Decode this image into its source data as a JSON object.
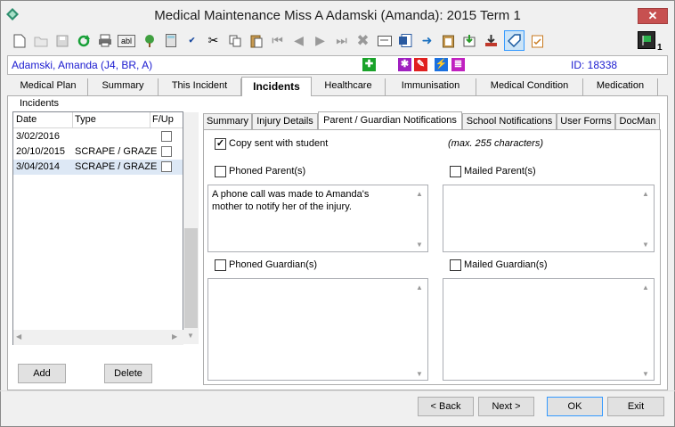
{
  "window": {
    "title": "Medical Maintenance   Miss A Adamski (Amanda): 2015 Term 1",
    "close_label": "✕"
  },
  "toolbar": {
    "icons": [
      "new-icon",
      "open-icon",
      "save-icon",
      "refresh-icon",
      "print-icon",
      "abl-icon",
      "tree-icon",
      "calculator-icon",
      "spellcheck-icon",
      "cut-icon",
      "copy-icon",
      "paste-icon",
      "first-icon",
      "prev-icon",
      "next-icon",
      "last-icon",
      "delete-icon",
      "card-icon",
      "word-icon",
      "forward-icon",
      "clipboard-icon",
      "export-icon",
      "download-icon",
      "tag-icon",
      "report-icon"
    ],
    "abl_label": "abl",
    "flag_count": "1"
  },
  "student": {
    "name": "Adamski, Amanda (J4, BR, A)",
    "id": "ID: 18338",
    "alert_colors": [
      "#1aa32a",
      "#a020c0",
      "#e02020",
      "#1a70e0",
      "#c020c0"
    ]
  },
  "main_tabs": [
    {
      "label": "Medical Plan"
    },
    {
      "label": "Summary"
    },
    {
      "label": "This Incident"
    },
    {
      "label": "Incidents"
    },
    {
      "label": "Healthcare"
    },
    {
      "label": "Immunisation"
    },
    {
      "label": "Medical Condition"
    },
    {
      "label": "Medication"
    }
  ],
  "incidents": {
    "label": "Incidents",
    "columns": [
      "Date",
      "Type",
      "F/Up"
    ],
    "rows": [
      {
        "date": "3/02/2016",
        "type": ""
      },
      {
        "date": "20/10/2015",
        "type": "SCRAPE / GRAZE"
      },
      {
        "date": "3/04/2014",
        "type": "SCRAPE / GRAZE"
      }
    ],
    "add_label": "Add",
    "delete_label": "Delete"
  },
  "sub_tabs": [
    {
      "label": "Summary"
    },
    {
      "label": "Injury Details"
    },
    {
      "label": "Parent / Guardian Notifications"
    },
    {
      "label": "School Notifications"
    },
    {
      "label": "User Forms"
    },
    {
      "label": "DocMan"
    }
  ],
  "notifications": {
    "copy_sent_label": "Copy sent with student",
    "copy_sent_checked": true,
    "max_note": "(max. 255 characters)",
    "phoned_parent_label": "Phoned Parent(s)",
    "mailed_parent_label": "Mailed Parent(s)",
    "phoned_parent_text": "A phone call was made to Amanda's mother to notify her of the injury.",
    "mailed_parent_text": "",
    "phoned_guardian_label": "Phoned Guardian(s)",
    "mailed_guardian_label": "Mailed Guardian(s)",
    "phoned_guardian_text": "",
    "mailed_guardian_text": ""
  },
  "footer": {
    "back_label": "< Back",
    "next_label": "Next >",
    "ok_label": "OK",
    "exit_label": "Exit"
  }
}
